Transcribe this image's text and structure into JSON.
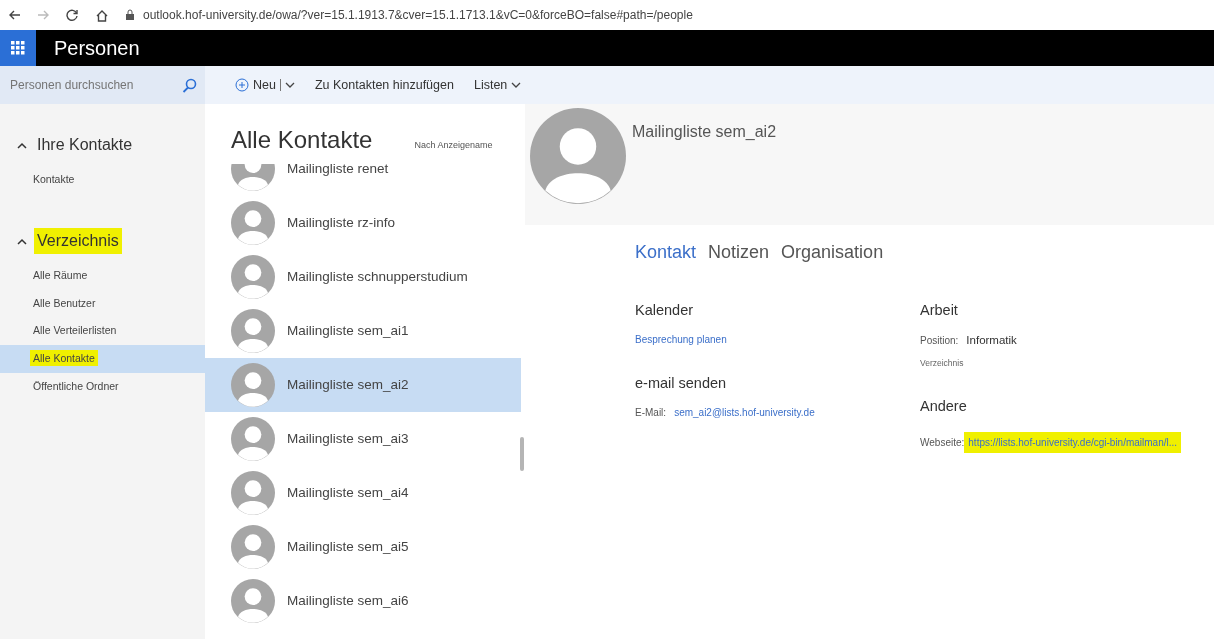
{
  "browser": {
    "url": "outlook.hof-university.de/owa/?ver=15.1.1913.7&cver=15.1.1713.1&vC=0&forceBO=false#path=/people"
  },
  "app": {
    "title": "Personen"
  },
  "search": {
    "placeholder": "Personen durchsuchen"
  },
  "toolbar": [
    {
      "label": "Neu",
      "kind": "new"
    },
    {
      "label": "Zu Kontakten hinzufügen",
      "kind": "plain"
    },
    {
      "label": "Listen",
      "kind": "menu"
    }
  ],
  "sidebar": {
    "groups": [
      {
        "label": "Ihre Kontakte",
        "expanded": true,
        "highlighted": false,
        "children": [
          {
            "label": "Kontakte",
            "selected": false,
            "highlighted": false
          }
        ]
      },
      {
        "label": "Verzeichnis",
        "expanded": true,
        "highlighted": true,
        "children": [
          {
            "label": "Alle Räume",
            "selected": false,
            "highlighted": false
          },
          {
            "label": "Alle Benutzer",
            "selected": false,
            "highlighted": false
          },
          {
            "label": "Alle Verteilerlisten",
            "selected": false,
            "highlighted": false
          },
          {
            "label": "Alle Kontakte",
            "selected": true,
            "highlighted": true
          },
          {
            "label": "Öffentliche Ordner",
            "selected": false,
            "highlighted": false
          }
        ]
      }
    ]
  },
  "list": {
    "title": "Alle Kontakte",
    "sort": "Nach Anzeigename",
    "items": [
      {
        "name": "Mailingliste renet",
        "selected": false
      },
      {
        "name": "Mailingliste rz-info",
        "selected": false
      },
      {
        "name": "Mailingliste schnupperstudium",
        "selected": false
      },
      {
        "name": "Mailingliste sem_ai1",
        "selected": false
      },
      {
        "name": "Mailingliste sem_ai2",
        "selected": true
      },
      {
        "name": "Mailingliste sem_ai3",
        "selected": false
      },
      {
        "name": "Mailingliste sem_ai4",
        "selected": false
      },
      {
        "name": "Mailingliste sem_ai5",
        "selected": false
      },
      {
        "name": "Mailingliste sem_ai6",
        "selected": false
      }
    ]
  },
  "detail": {
    "name": "Mailingliste sem_ai2",
    "tabs": [
      {
        "label": "Kontakt",
        "selected": true
      },
      {
        "label": "Notizen",
        "selected": false
      },
      {
        "label": "Organisation",
        "selected": false
      }
    ],
    "left": [
      {
        "heading": "Kalender",
        "rows": [
          {
            "label": "",
            "value": "Besprechung planen",
            "kind": "link",
            "highlighted": false
          }
        ]
      },
      {
        "heading": "e-mail senden",
        "rows": [
          {
            "label": "E-Mail:",
            "value": "sem_ai2@lists.hof-university.de",
            "kind": "link",
            "highlighted": false
          }
        ]
      }
    ],
    "right": [
      {
        "heading": "Arbeit",
        "rows": [
          {
            "label": "Position:",
            "value": "Informatik",
            "kind": "text",
            "highlighted": false
          },
          {
            "label": "",
            "value": "Verzeichnis",
            "kind": "note",
            "highlighted": false
          }
        ]
      },
      {
        "heading": "Andere",
        "rows": [
          {
            "label": "Webseite:",
            "value": "https://lists.hof-university.de/cgi-bin/mailman/l...",
            "kind": "block-link",
            "highlighted": true
          }
        ]
      }
    ]
  }
}
